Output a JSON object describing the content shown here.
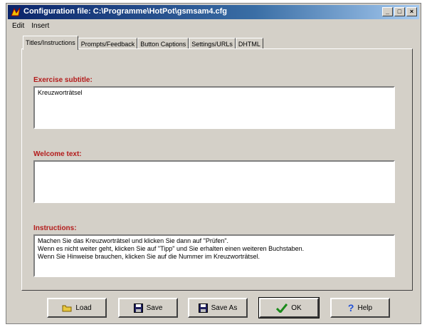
{
  "window": {
    "title": "Configuration file: C:\\Programme\\HotPot\\gsmsam4.cfg",
    "controls": {
      "minimize": "_",
      "maximize": "□",
      "close": "×"
    }
  },
  "menu": {
    "items": [
      {
        "label": "Edit"
      },
      {
        "label": "Insert"
      }
    ]
  },
  "tabs": [
    {
      "label": "Titles/Instructions",
      "active": true
    },
    {
      "label": "Prompts/Feedback",
      "active": false
    },
    {
      "label": "Button Captions",
      "active": false
    },
    {
      "label": "Settings/URLs",
      "active": false
    },
    {
      "label": "DHTML",
      "active": false
    }
  ],
  "fields": {
    "subtitle": {
      "label": "Exercise subtitle:",
      "value": "Kreuzworträtsel"
    },
    "welcome": {
      "label": "Welcome text:",
      "value": ""
    },
    "instructions": {
      "label": "Instructions:",
      "value": "Machen Sie das Kreuzworträtsel und klicken Sie dann auf \"Prüfen\".\nWenn es nicht weiter geht, klicken Sie auf \"Tipp\" und Sie erhalten einen weiteren Buchstaben.\nWenn Sie Hinweise brauchen, klicken Sie auf die Nummer im Kreuzworträtsel."
    }
  },
  "buttons": {
    "load": {
      "label": "Load",
      "icon": "load-icon"
    },
    "save": {
      "label": "Save",
      "icon": "floppy-disk-icon"
    },
    "save_as": {
      "label": "Save As",
      "icon": "floppy-disk-icon"
    },
    "ok": {
      "label": "OK",
      "icon": "checkmark-icon"
    },
    "help": {
      "label": "Help",
      "icon": "question-mark-icon"
    }
  },
  "colors": {
    "title_bar": "#0a246a",
    "label_red": "#b31b1b",
    "face": "#d4d0c8"
  }
}
